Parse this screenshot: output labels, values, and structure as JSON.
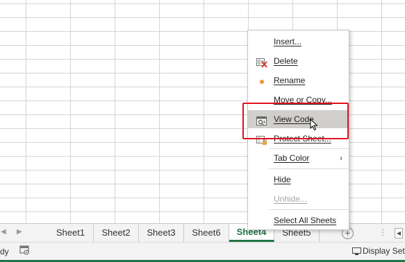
{
  "tabs": {
    "sheets": [
      "Sheet1",
      "Sheet2",
      "Sheet3",
      "Sheet6",
      "Sheet4",
      "Sheet5"
    ],
    "active": "Sheet4"
  },
  "context_menu": {
    "insert": "Insert...",
    "delete": "Delete",
    "rename": "Rename",
    "move_copy": "Move or Copy...",
    "view_code": "View Code",
    "protect_sheet": "Protect Sheet...",
    "tab_color": "Tab Color",
    "hide": "Hide",
    "unhide": "Unhide...",
    "select_all": "Select All Sheets"
  },
  "status": {
    "left_text": "dy",
    "display_settings": "Display Sett"
  },
  "colors": {
    "accent": "#217346",
    "highlight": "#e3101e"
  }
}
